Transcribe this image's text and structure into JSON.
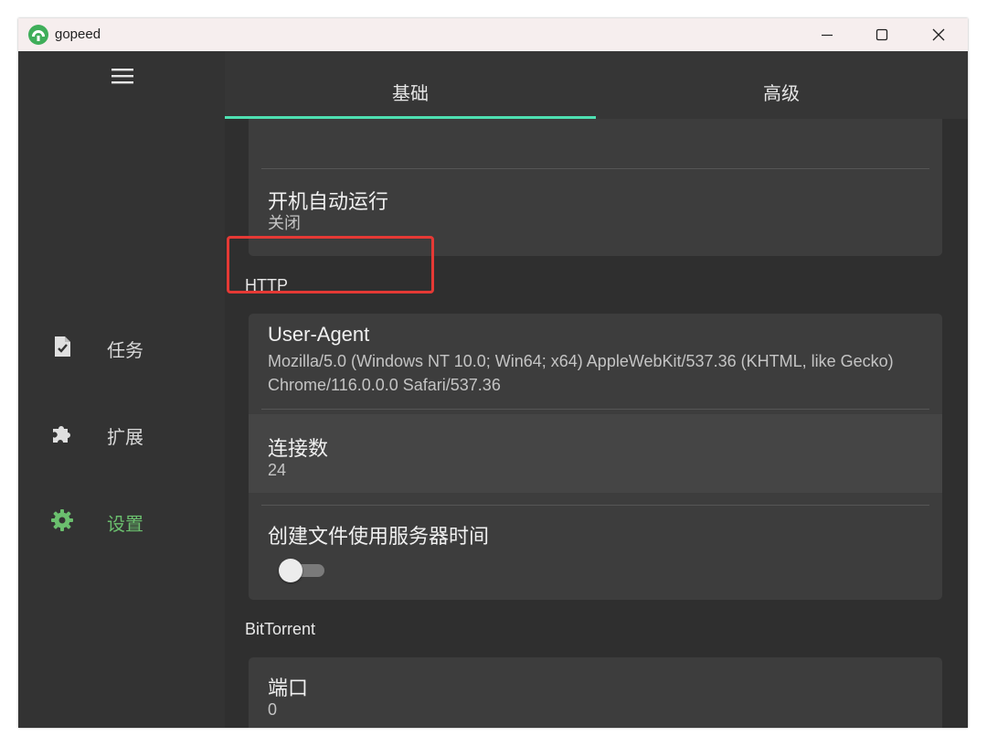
{
  "window": {
    "title": "gopeed",
    "controls": {
      "minimize_icon": "minimize-icon",
      "maximize_icon": "maximize-icon",
      "close_icon": "close-icon"
    }
  },
  "colors": {
    "accent": "#4ee0b2",
    "active_nav": "#6bbf6e",
    "highlight_border": "#e53935"
  },
  "sidebar": {
    "menu_icon": "hamburger-menu-icon",
    "items": [
      {
        "label": "任务",
        "icon": "task-file-check-icon",
        "active": false
      },
      {
        "label": "扩展",
        "icon": "puzzle-piece-icon",
        "active": false
      },
      {
        "label": "设置",
        "icon": "gear-icon",
        "active": true
      }
    ]
  },
  "tabs": [
    {
      "label": "基础",
      "active": true
    },
    {
      "label": "高级",
      "active": false
    }
  ],
  "settings": {
    "autostart": {
      "title": "开机自动运行",
      "value": "关闭"
    },
    "http": {
      "section_label": "HTTP",
      "user_agent": {
        "title": "User-Agent",
        "value": "Mozilla/5.0 (Windows NT 10.0; Win64; x64) AppleWebKit/537.36 (KHTML, like Gecko) Chrome/116.0.0.0 Safari/537.36"
      },
      "connections": {
        "title": "连接数",
        "value": "24"
      },
      "server_time": {
        "title": "创建文件使用服务器时间",
        "enabled": false
      }
    },
    "bittorrent": {
      "section_label": "BitTorrent",
      "port": {
        "title": "端口",
        "value": "0"
      }
    }
  }
}
